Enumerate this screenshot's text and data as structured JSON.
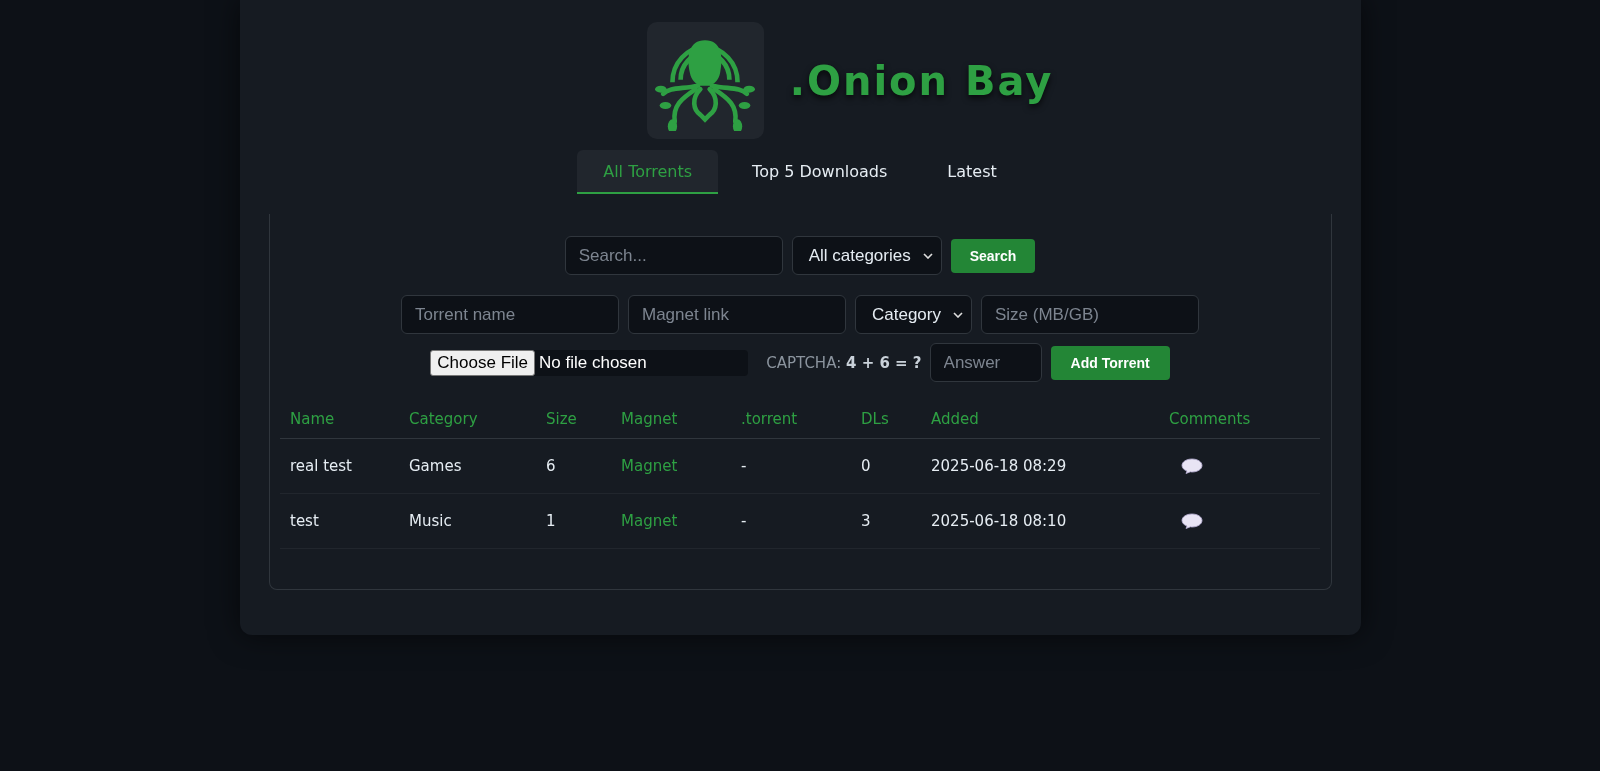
{
  "site": {
    "title": ".Onion Bay"
  },
  "tabs": [
    {
      "label": "All Torrents",
      "selected": true
    },
    {
      "label": "Top 5 Downloads",
      "selected": false
    },
    {
      "label": "Latest",
      "selected": false
    }
  ],
  "search": {
    "placeholder": "Search...",
    "category": "All categories",
    "button": "Search"
  },
  "upload": {
    "name_placeholder": "Torrent name",
    "magnet_placeholder": "Magnet link",
    "category": "Category",
    "size_placeholder": "Size (MB/GB)",
    "file_button": "Choose File",
    "file_status": "No file chosen",
    "captcha": "CAPTCHA: **4 + 6 = ?**",
    "answer_placeholder": "Answer",
    "button": "Add Torrent"
  },
  "table": {
    "columns": [
      "Name",
      "Category",
      "Size",
      "Magnet",
      ".torrent",
      "DLs",
      "Added",
      "Comments"
    ],
    "rows": [
      {
        "name": "real test",
        "category": "Games",
        "size": "6",
        "magnet": "Magnet",
        "torrent": "-",
        "dls": "0",
        "added": "2025-06-18 08:29"
      },
      {
        "name": "test",
        "category": "Music",
        "size": "1",
        "magnet": "Magnet",
        "torrent": "-",
        "dls": "3",
        "added": "2025-06-18 08:10"
      }
    ]
  }
}
